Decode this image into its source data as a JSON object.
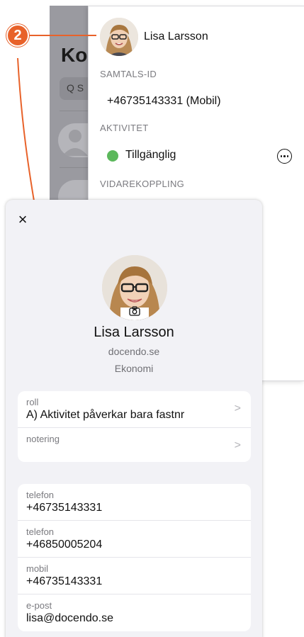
{
  "callout": {
    "number": "2"
  },
  "background": {
    "title": "Ko",
    "search": "Q S"
  },
  "popup": {
    "name": "Lisa Larsson",
    "sections": {
      "call_id": "SAMTALS-ID",
      "activity": "AKTIVITET",
      "forwarding": "VIDAREKOPPLING"
    },
    "phone": "+46735143331 (Mobil)",
    "status": "Tillgänglig",
    "status_color": "#5cb85c"
  },
  "sheet": {
    "close_icon": "×",
    "name": "Lisa Larsson",
    "domain": "docendo.se",
    "department": "Ekonomi",
    "info_rows": [
      {
        "label": "roll",
        "value": "A) Aktivitet påverkar bara fastnr"
      },
      {
        "label": "notering",
        "value": ""
      }
    ],
    "contact_rows": [
      {
        "label": "telefon",
        "value": "+46735143331"
      },
      {
        "label": "telefon",
        "value": "+46850005204"
      },
      {
        "label": "mobil",
        "value": "+46735143331"
      },
      {
        "label": "e-post",
        "value": "lisa@docendo.se"
      }
    ]
  },
  "colors": {
    "accent": "#e8622a",
    "sheet_bg": "#f2f2f6"
  }
}
